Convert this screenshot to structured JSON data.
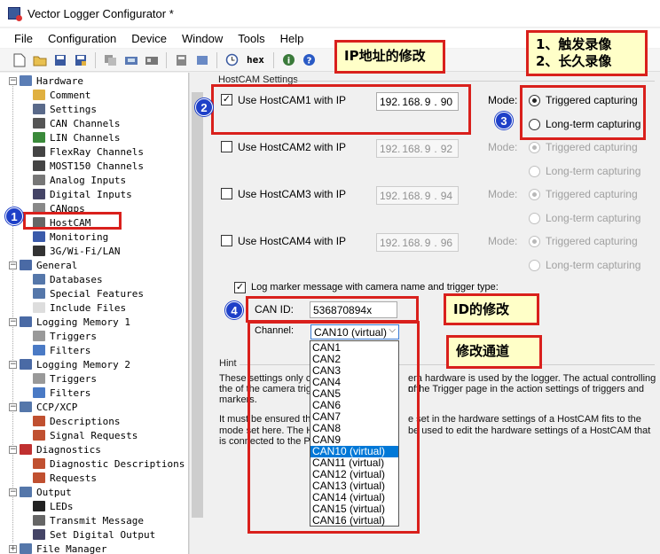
{
  "window": {
    "title": "Vector Logger Configurator *"
  },
  "menu": [
    "File",
    "Configuration",
    "Device",
    "Window",
    "Tools",
    "Help"
  ],
  "toolbar": {
    "hex_label": "hex"
  },
  "tree": [
    {
      "label": "Hardware",
      "level": 0,
      "expander": "−",
      "icon": "hardware-icon",
      "color": "#5a7db5"
    },
    {
      "label": "Comment",
      "level": 1,
      "icon": "comment-icon",
      "color": "#e0b040"
    },
    {
      "label": "Settings",
      "level": 1,
      "icon": "settings-icon",
      "color": "#5a6a8a"
    },
    {
      "label": "CAN Channels",
      "level": 1,
      "icon": "can-icon",
      "color": "#555"
    },
    {
      "label": "LIN Channels",
      "level": 1,
      "icon": "lin-icon",
      "color": "#3a8a3a"
    },
    {
      "label": "FlexRay Channels",
      "level": 1,
      "icon": "flexray-icon",
      "color": "#444"
    },
    {
      "label": "MOST150 Channels",
      "level": 1,
      "icon": "most-icon",
      "color": "#444"
    },
    {
      "label": "Analog Inputs",
      "level": 1,
      "icon": "analog-icon",
      "color": "#777"
    },
    {
      "label": "Digital Inputs",
      "level": 1,
      "icon": "digital-icon",
      "color": "#446"
    },
    {
      "label": "CANgps",
      "level": 1,
      "icon": "gps-icon",
      "color": "#888"
    },
    {
      "label": "HostCAM",
      "level": 1,
      "icon": "camera-icon",
      "color": "#666"
    },
    {
      "label": "Monitoring",
      "level": 1,
      "icon": "monitoring-icon",
      "color": "#3a5aaa"
    },
    {
      "label": "3G/Wi-Fi/LAN",
      "level": 1,
      "icon": "network-icon",
      "color": "#333"
    },
    {
      "label": "General",
      "level": 0,
      "expander": "−",
      "icon": "general-icon",
      "color": "#4a6aa5"
    },
    {
      "label": "Databases",
      "level": 1,
      "icon": "database-icon",
      "color": "#5577aa"
    },
    {
      "label": "Special Features",
      "level": 1,
      "icon": "features-icon",
      "color": "#5577aa"
    },
    {
      "label": "Include Files",
      "level": 1,
      "icon": "include-icon",
      "color": "#dddddd"
    },
    {
      "label": "Logging Memory 1",
      "level": 0,
      "expander": "−",
      "icon": "memory-icon",
      "color": "#4a6aa5"
    },
    {
      "label": "Triggers",
      "level": 1,
      "icon": "trigger-icon",
      "color": "#999"
    },
    {
      "label": "Filters",
      "level": 1,
      "icon": "filter-icon",
      "color": "#4a7ac5"
    },
    {
      "label": "Logging Memory 2",
      "level": 0,
      "expander": "−",
      "icon": "memory-icon",
      "color": "#4a6aa5"
    },
    {
      "label": "Triggers",
      "level": 1,
      "icon": "trigger-icon",
      "color": "#999"
    },
    {
      "label": "Filters",
      "level": 1,
      "icon": "filter-icon",
      "color": "#4a7ac5"
    },
    {
      "label": "CCP/XCP",
      "level": 0,
      "expander": "−",
      "icon": "ccp-icon",
      "color": "#5577aa"
    },
    {
      "label": "Descriptions",
      "level": 1,
      "icon": "descriptions-icon",
      "color": "#c05030"
    },
    {
      "label": "Signal Requests",
      "level": 1,
      "icon": "signal-request-icon",
      "color": "#c05030"
    },
    {
      "label": "Diagnostics",
      "level": 0,
      "expander": "−",
      "icon": "diagnostics-icon",
      "color": "#c03030"
    },
    {
      "label": "Diagnostic Descriptions",
      "level": 1,
      "icon": "diag-desc-icon",
      "color": "#c05030"
    },
    {
      "label": "Requests",
      "level": 1,
      "icon": "requests-icon",
      "color": "#c05030"
    },
    {
      "label": "Output",
      "level": 0,
      "expander": "−",
      "icon": "output-icon",
      "color": "#5577aa"
    },
    {
      "label": "LEDs",
      "level": 1,
      "icon": "led-icon",
      "color": "#222"
    },
    {
      "label": "Transmit Message",
      "level": 1,
      "icon": "transmit-icon",
      "color": "#666"
    },
    {
      "label": "Set Digital Output",
      "level": 1,
      "icon": "digital-output-icon",
      "color": "#446"
    },
    {
      "label": "File Manager",
      "level": 0,
      "expander": "+",
      "icon": "file-manager-icon",
      "color": "#5577aa"
    }
  ],
  "hostcam": {
    "section_title": "HostCAM Settings",
    "mode_label": "Mode:",
    "triggered_label": "Triggered capturing",
    "longterm_label": "Long-term capturing",
    "cams": [
      {
        "label": "Use HostCAM1 with IP",
        "ip": [
          "192.",
          "168.",
          "9",
          ".",
          "90"
        ],
        "checked": true,
        "enabled": true,
        "mode": "triggered"
      },
      {
        "label": "Use HostCAM2 with IP",
        "ip": [
          "192.",
          "168.",
          "9",
          ".",
          "92"
        ],
        "checked": false,
        "enabled": false,
        "mode": "triggered"
      },
      {
        "label": "Use HostCAM3 with IP",
        "ip": [
          "192.",
          "168.",
          "9",
          ".",
          "94"
        ],
        "checked": false,
        "enabled": false,
        "mode": "triggered"
      },
      {
        "label": "Use HostCAM4 with IP",
        "ip": [
          "192.",
          "168.",
          "9",
          ".",
          "96"
        ],
        "checked": false,
        "enabled": false,
        "mode": "triggered"
      }
    ],
    "log_marker_label": "Log marker message with camera name and trigger type:",
    "can_id_label": "CAN ID:",
    "can_id_value": "536870894x",
    "channel_label": "Channel:",
    "channel_value": "CAN10 (virtual)",
    "channel_options": [
      "CAN1",
      "CAN2",
      "CAN3",
      "CAN4",
      "CAN5",
      "CAN6",
      "CAN7",
      "CAN8",
      "CAN9",
      "CAN10 (virtual)",
      "CAN11 (virtual)",
      "CAN12 (virtual)",
      "CAN13 (virtual)",
      "CAN14 (virtual)",
      "CAN15 (virtual)",
      "CAN16 (virtual)"
    ],
    "selected_channel_index": 9
  },
  "hint": {
    "title": "Hint",
    "line1a": "These settings only co",
    "line1b": "era hardware is used by the logger. The actual controlling of",
    "line2a": "the  of the camera trig",
    "line2b": "n the Trigger page in the action settings of triggers and",
    "line3a": "markers.",
    "line4a": "It must be ensured th",
    "line4b": "e set in the hardware settings of a HostCAM fits to the",
    "line5a": "mode set here. The H",
    "line5b": "be used to edit the hardware settings of a HostCAM that",
    "line6a": "is connected to the P"
  },
  "annotations": {
    "callout_ip": "IP地址的修改",
    "callout_mode_1": "1、触发录像",
    "callout_mode_2": "2、长久录像",
    "callout_canid": "ID的修改",
    "callout_channel": "修改通道",
    "badge1": "1",
    "badge2": "2",
    "badge3": "3",
    "badge4": "4",
    "accent_red": "#d9201c",
    "badge_blue": "#1e40c8"
  }
}
